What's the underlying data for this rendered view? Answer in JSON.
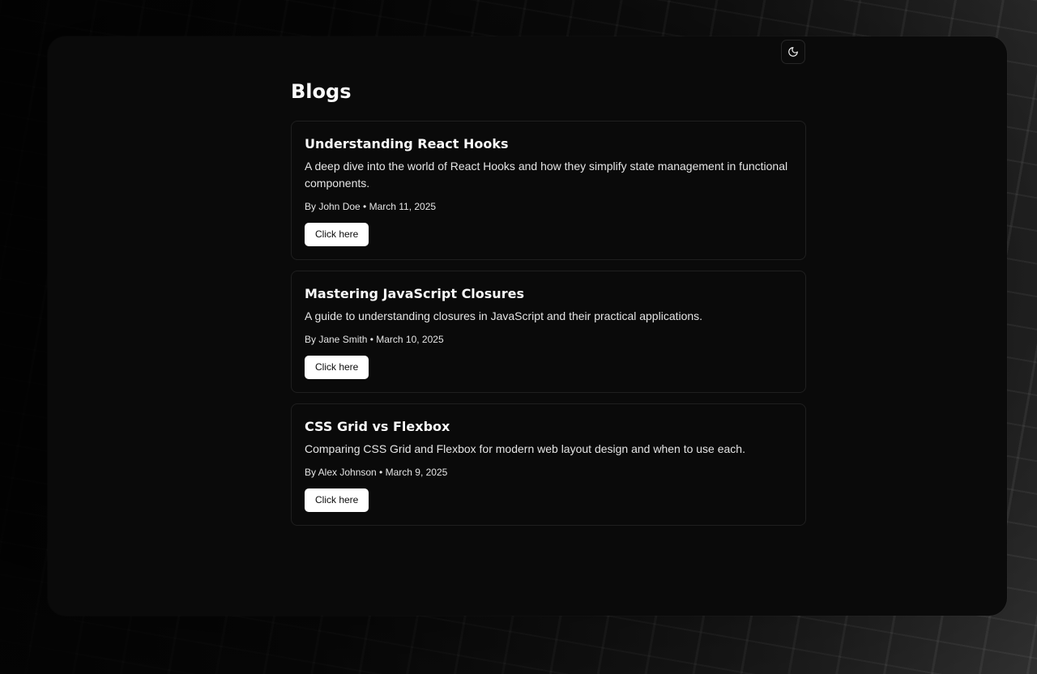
{
  "page": {
    "title": "Blogs"
  },
  "theme_toggle": {
    "icon": "moon-icon"
  },
  "posts": [
    {
      "title": "Understanding React Hooks",
      "description": "A deep dive into the world of React Hooks and how they simplify state management in functional components.",
      "meta": "By John Doe • March 11, 2025",
      "button_label": "Click here"
    },
    {
      "title": "Mastering JavaScript Closures",
      "description": "A guide to understanding closures in JavaScript and their practical applications.",
      "meta": "By Jane Smith • March 10, 2025",
      "button_label": "Click here"
    },
    {
      "title": "CSS Grid vs Flexbox",
      "description": "Comparing CSS Grid and Flexbox for modern web layout design and when to use each.",
      "meta": "By Alex Johnson • March 9, 2025",
      "button_label": "Click here"
    }
  ],
  "colors": {
    "panel_background": "#0a0a0a",
    "card_border": "#1f1f1f",
    "text_primary": "#fafafa",
    "button_background": "#ffffff",
    "button_text": "#0a0a0a"
  }
}
